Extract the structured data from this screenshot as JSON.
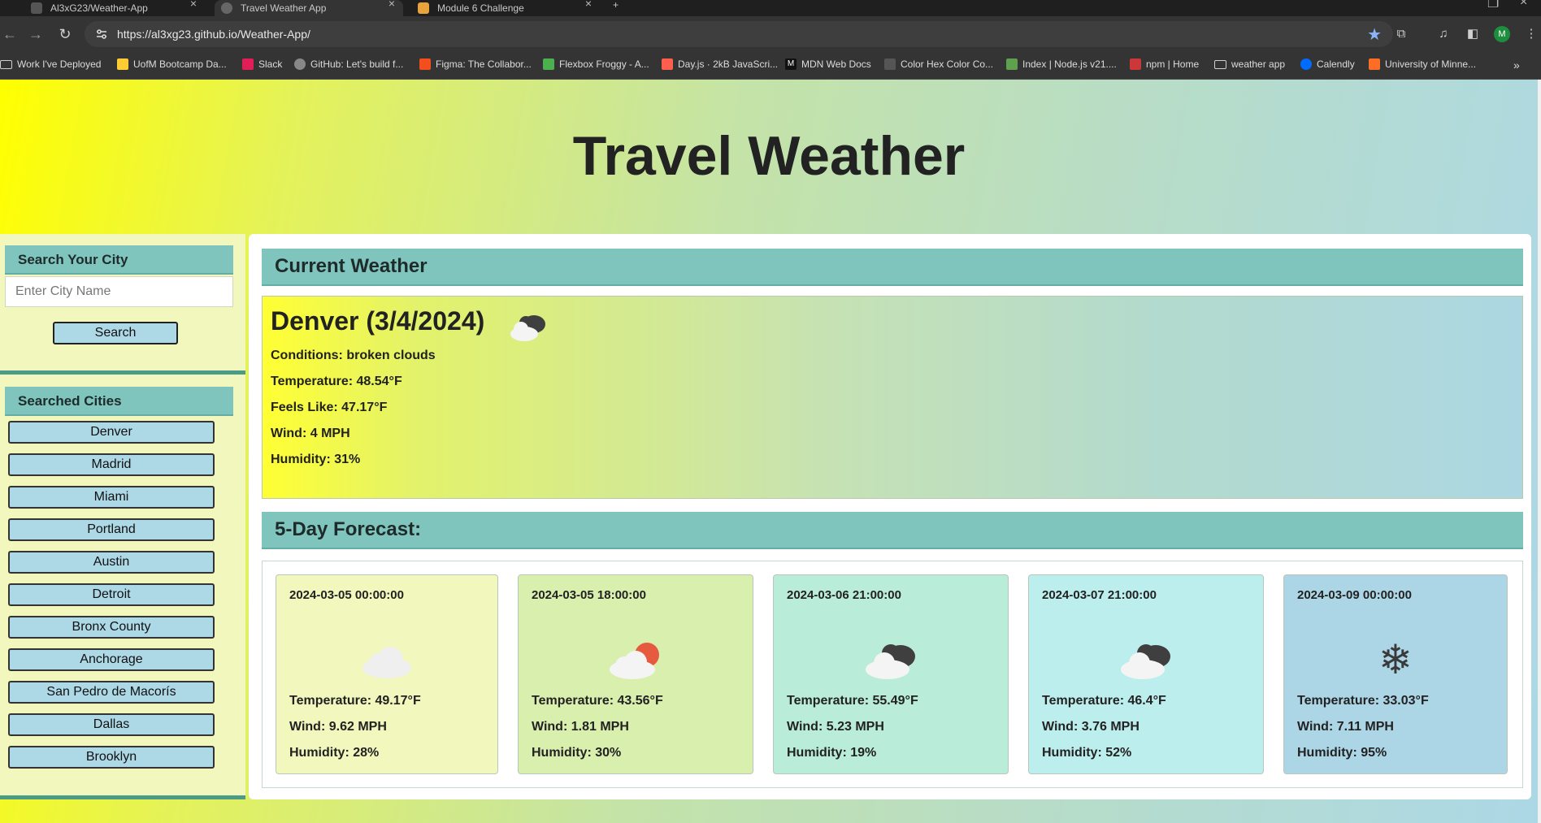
{
  "browser": {
    "tabs": [
      {
        "title": "Al3xG23/Weather-App",
        "active": false
      },
      {
        "title": "Travel Weather App",
        "active": true
      },
      {
        "title": "Module 6 Challenge",
        "active": false
      }
    ],
    "new_tab_label": "+",
    "url": "https://al3xg23.github.io/Weather-App/",
    "profile_initial": "M",
    "bookmarks": [
      {
        "label": "Work I've Deployed",
        "icon": "folder-icon"
      },
      {
        "label": "UofM Bootcamp Da...",
        "icon": "uofm-icon",
        "color": "#ffcc33"
      },
      {
        "label": "Slack",
        "icon": "slack-icon",
        "color": "#e01e5a"
      },
      {
        "label": "GitHub: Let's build f...",
        "icon": "github-icon",
        "color": "#888888"
      },
      {
        "label": "Figma: The Collabor...",
        "icon": "figma-icon",
        "color": "#f24e1e"
      },
      {
        "label": "Flexbox Froggy - A...",
        "icon": "froggy-icon",
        "color": "#4caf50"
      },
      {
        "label": "Day.js · 2kB JavaScri...",
        "icon": "dayjs-icon",
        "color": "#ff5f4c"
      },
      {
        "label": "MDN Web Docs",
        "icon": "mdn-icon",
        "color": "#111111"
      },
      {
        "label": "Color Hex Color Co...",
        "icon": "colorhex-icon",
        "color": "#555555"
      },
      {
        "label": "Index | Node.js v21....",
        "icon": "node-icon",
        "color": "#5fa04e"
      },
      {
        "label": "npm | Home",
        "icon": "npm-icon",
        "color": "#cb3837"
      },
      {
        "label": "weather app",
        "icon": "folder-icon"
      },
      {
        "label": "Calendly",
        "icon": "calendly-icon",
        "color": "#006bff"
      },
      {
        "label": "University of Minne...",
        "icon": "gitlab-icon",
        "color": "#fc6d26"
      }
    ]
  },
  "header": {
    "title": "Travel Weather"
  },
  "sidebar": {
    "search_heading": "Search Your City",
    "search_placeholder": "Enter City Name",
    "search_value": "",
    "search_button": "Search",
    "history_heading": "Searched Cities",
    "cities": [
      "Denver",
      "Madrid",
      "Miami",
      "Portland",
      "Austin",
      "Detroit",
      "Bronx County",
      "Anchorage",
      "San Pedro de Macorís",
      "Dallas",
      "Brooklyn"
    ]
  },
  "current": {
    "heading": "Current Weather",
    "city_date": "Denver (3/4/2024)",
    "icon": "broken-clouds-icon",
    "conditions": "Conditions: broken clouds",
    "temperature": "Temperature: 48.54°F",
    "feels_like": "Feels Like: 47.17°F",
    "wind": "Wind: 4 MPH",
    "humidity": "Humidity: 31%"
  },
  "forecast": {
    "heading": "5-Day Forecast:",
    "days": [
      {
        "date": "2024-03-05 00:00:00",
        "icon": "cloud-icon",
        "temp": "Temperature: 49.17°F",
        "wind": "Wind: 9.62 MPH",
        "humidity": "Humidity: 28%",
        "bg": "#f2f8bd"
      },
      {
        "date": "2024-03-05 18:00:00",
        "icon": "sun-cloud-icon",
        "temp": "Temperature: 43.56°F",
        "wind": "Wind: 1.81 MPH",
        "humidity": "Humidity: 30%",
        "bg": "#d9efae"
      },
      {
        "date": "2024-03-06 21:00:00",
        "icon": "broken-clouds-icon",
        "temp": "Temperature: 55.49°F",
        "wind": "Wind: 5.23 MPH",
        "humidity": "Humidity: 19%",
        "bg": "#b9ecd9"
      },
      {
        "date": "2024-03-07 21:00:00",
        "icon": "broken-clouds-icon",
        "temp": "Temperature: 46.4°F",
        "wind": "Wind: 3.76 MPH",
        "humidity": "Humidity: 52%",
        "bg": "#bdeeee"
      },
      {
        "date": "2024-03-09 00:00:00",
        "icon": "snowflake-icon",
        "temp": "Temperature: 33.03°F",
        "wind": "Wind: 7.11 MPH",
        "humidity": "Humidity: 95%",
        "bg": "#acd6e6"
      }
    ]
  }
}
